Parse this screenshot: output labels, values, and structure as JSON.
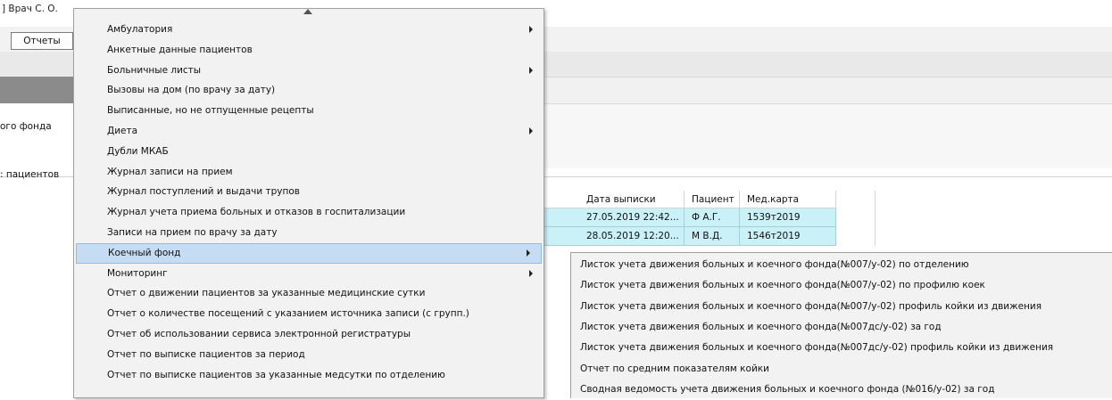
{
  "window": {
    "title": "] Врач С. О."
  },
  "menubar": {
    "reports_label": "Отчеты"
  },
  "left_labels": {
    "fund": "ого фонда",
    "patients": ": пациентов"
  },
  "grid": {
    "columns": [
      "Дата выписки",
      "Пациент",
      "Мед.карта"
    ],
    "rows": [
      [
        "27.05.2019 22:42...",
        "Ф А.Г.",
        "1539т2019"
      ],
      [
        "28.05.2019 12:20...",
        "М В.Д.",
        "1546т2019"
      ]
    ]
  },
  "main_menu": {
    "items": [
      {
        "label": "Амбулатория",
        "submenu": true
      },
      {
        "label": "Анкетные данные пациентов",
        "submenu": false
      },
      {
        "label": "Больничные листы",
        "submenu": true
      },
      {
        "label": "Вызовы на дом (по врачу за дату)",
        "submenu": false
      },
      {
        "label": "Выписанные, но не отпущенные рецепты",
        "submenu": false
      },
      {
        "label": "Диета",
        "submenu": true
      },
      {
        "label": "Дубли МКАБ",
        "submenu": false
      },
      {
        "label": "Журнал записи на прием",
        "submenu": false
      },
      {
        "label": "Журнал поступлений и выдачи трупов",
        "submenu": false
      },
      {
        "label": "Журнал учета приема больных и отказов в госпитализации",
        "submenu": false
      },
      {
        "label": "Записи на прием по врачу за дату",
        "submenu": false
      },
      {
        "label": "Коечный фонд",
        "submenu": true,
        "selected": true
      },
      {
        "label": "Мониторинг",
        "submenu": true
      },
      {
        "label": "Отчет о движении пациентов за указанные медицинские сутки",
        "submenu": false
      },
      {
        "label": "Отчет о количестве посещений с указанием источника записи (с групп.)",
        "submenu": false
      },
      {
        "label": "Отчет об использовании сервиса электронной регистратуры",
        "submenu": false
      },
      {
        "label": "Отчет по выписке пациентов за период",
        "submenu": false
      },
      {
        "label": "Отчет по выписке пациентов за указанные медсутки по отделению",
        "submenu": false
      }
    ]
  },
  "sub_menu": {
    "items": [
      "Листок учета движения больных и коечного фонда(№007/у-02) по отделению",
      "Листок учета движения больных и коечного фонда(№007/у-02) по профилю коек",
      "Листок учета движения больных и коечного фонда(№007/у-02) профиль койки из движения",
      "Листок учета движения больных и коечного фонда(№007дс/у-02) за год",
      "Листок учета движения больных и коечного фонда(№007дс/у-02) профиль койки из движения",
      "Отчет по средним показателям койки",
      "Сводная ведомость учета движения больных и коечного фонда (№016/у-02) за год"
    ]
  },
  "colors": {
    "menu_bg": "#f2f2f2",
    "selected_bg": "#c6dcf3",
    "selected_border": "#92bce8",
    "grid_row_bg": "#c9f1f7"
  },
  "icons": [
    "scroll-up-icon",
    "submenu-arrow-icon"
  ]
}
